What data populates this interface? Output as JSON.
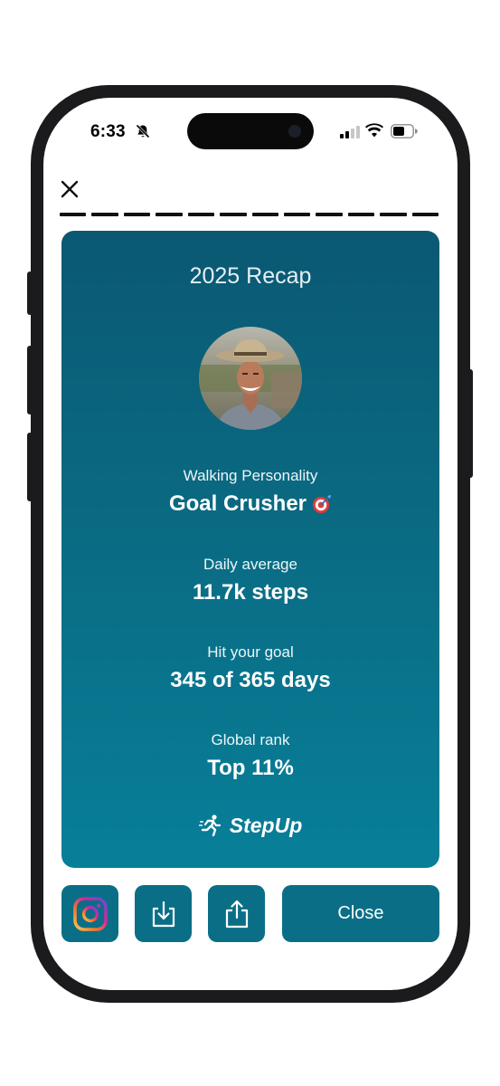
{
  "status_bar": {
    "time": "6:33",
    "icons": [
      "bell-slash-icon",
      "signal-icon",
      "wifi-icon",
      "battery-icon"
    ]
  },
  "header": {
    "close_icon": "close-icon",
    "story_segments": 12
  },
  "recap": {
    "title": "2025 Recap",
    "personality_label": "Walking Personality",
    "personality_value": "Goal Crusher",
    "personality_icon": "dart-target-icon",
    "daily_average_label": "Daily average",
    "daily_average_value": "11.7k steps",
    "goal_label": "Hit your goal",
    "goal_value": "345 of 365 days",
    "rank_label": "Global rank",
    "rank_value": "Top 11%",
    "brand_name": "StepUp",
    "brand_icon": "runner-icon"
  },
  "actions": {
    "instagram_icon": "instagram-icon",
    "download_icon": "download-icon",
    "share_icon": "share-icon",
    "close_label": "Close"
  },
  "colors": {
    "card_top": "#0b5873",
    "card_bottom": "#087f99",
    "button": "#0a6f86"
  }
}
